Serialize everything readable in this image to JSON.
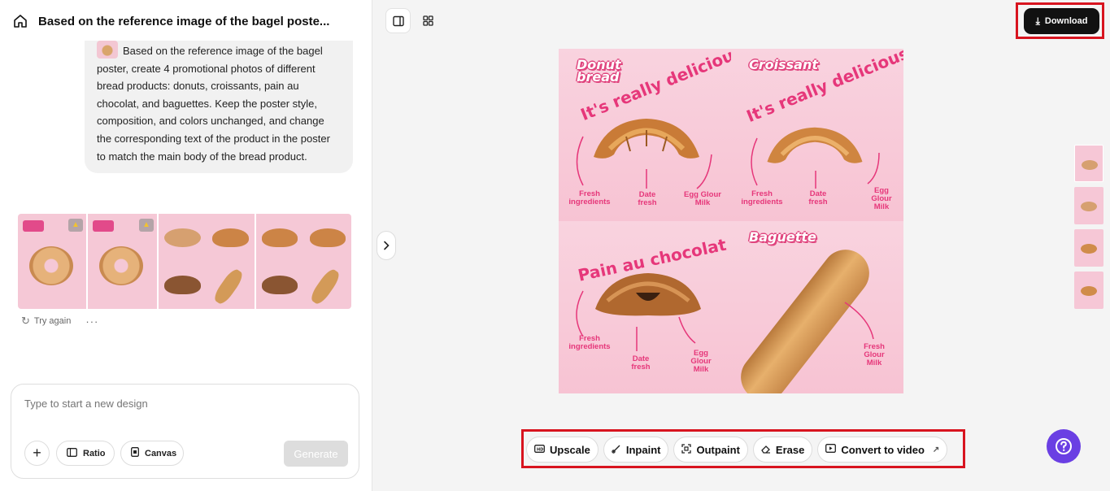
{
  "header": {
    "title": "Based on the reference image of the bagel poste..."
  },
  "prompt": {
    "text": "Based on the reference image of the bagel poster, create 4 promotional photos of different bread products: donuts, croissants, pain au chocolat, and baguettes. Keep the poster style, composition, and colors unchanged, and change the corresponding text of the product in the poster to match the main body of the bread product."
  },
  "results": {
    "try_again_label": "Try again",
    "more_label": "···"
  },
  "composer": {
    "placeholder": "Type to start a new design",
    "ratio_label": "Ratio",
    "canvas_label": "Canvas",
    "generate_label": "Generate"
  },
  "toolbar": {
    "download_label": "Download"
  },
  "poster": {
    "cells": [
      {
        "title_line1": "Donut",
        "title_line2": "bread",
        "headline": "It's really delicious!",
        "labels": [
          "Fresh ingredients",
          "Date fresh",
          "Egg Glour Milk"
        ]
      },
      {
        "title_line1": "Croissant",
        "headline": "It's really delicious!",
        "labels": [
          "Fresh ingredients",
          "Date fresh",
          "Egg Glour Milk"
        ]
      },
      {
        "title_line1": "",
        "headline": "Pain au chocolat",
        "labels": [
          "Fresh ingredients",
          "Date fresh",
          "Egg Glour Milk"
        ]
      },
      {
        "title_line1": "Baguette",
        "headline": "",
        "labels": [
          "Fresh Glour Milk"
        ]
      }
    ]
  },
  "actions": {
    "upscale": "Upscale",
    "inpaint": "Inpaint",
    "outpaint": "Outpaint",
    "erase": "Erase",
    "convert": "Convert to video"
  },
  "colors": {
    "accent_pink": "#e6377a",
    "highlight_red": "#d8141f",
    "help_purple": "#6a3fe3"
  }
}
